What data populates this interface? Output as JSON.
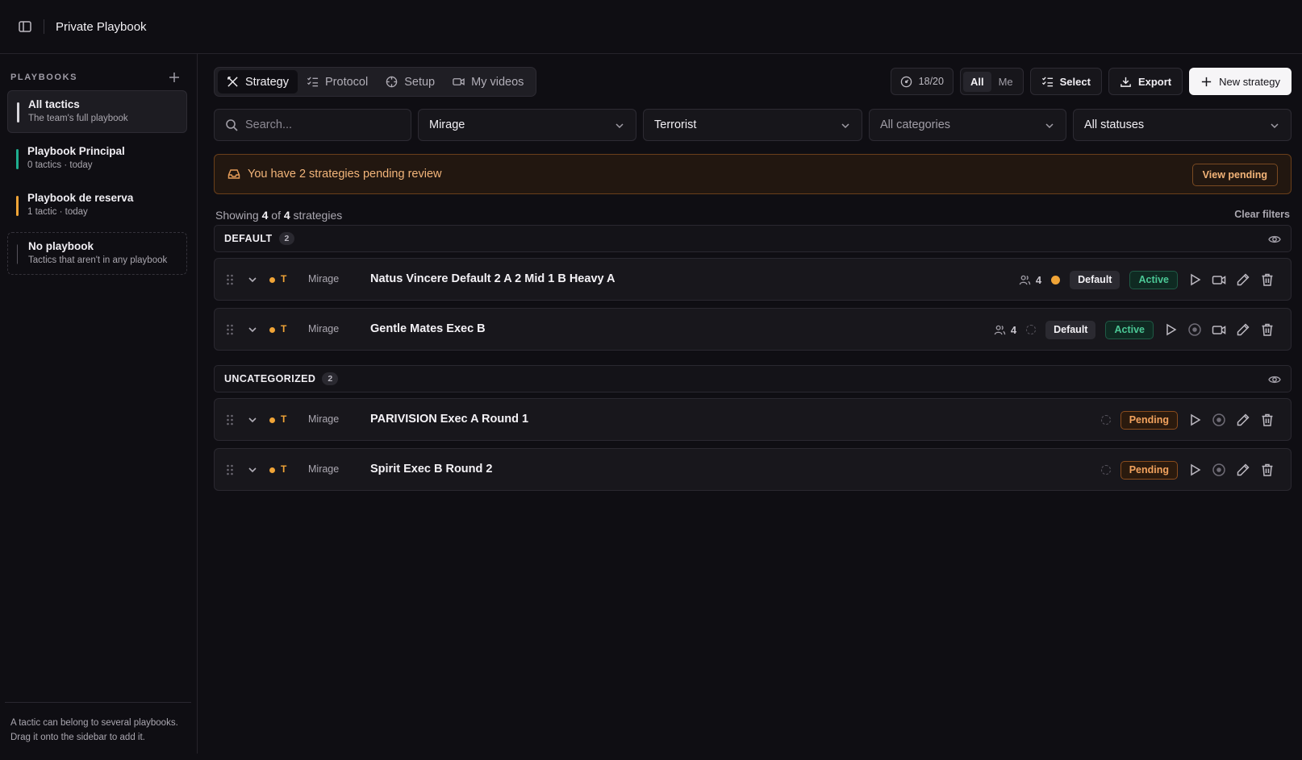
{
  "topbar": {
    "title": "Private Playbook"
  },
  "sidebar": {
    "heading": "PLAYBOOKS",
    "items": [
      {
        "name": "All tactics",
        "sub": "The team's full playbook",
        "color": "#d8d6dc"
      },
      {
        "name": "Playbook Principal",
        "sub": "0 tactics · today",
        "color": "#1fae8f"
      },
      {
        "name": "Playbook de reserva",
        "sub": "1 tactic · today",
        "color": "#f0a437"
      },
      {
        "name": "No playbook",
        "sub": "Tactics that aren't in any playbook",
        "color": ""
      }
    ],
    "footer_line1": "A tactic can belong to several playbooks.",
    "footer_line2": "Drag it onto the sidebar to add it."
  },
  "tabs": [
    "Strategy",
    "Protocol",
    "Setup",
    "My videos"
  ],
  "toolbar": {
    "quota": "18/20",
    "scope_all": "All",
    "scope_me": "Me",
    "select_label": "Select",
    "export_label": "Export",
    "new_label": "New strategy"
  },
  "filters": {
    "search_placeholder": "Search...",
    "map": "Mirage",
    "side": "Terrorist",
    "category": "All categories",
    "status": "All statuses"
  },
  "banner": {
    "text": "You have 2 strategies pending review",
    "button": "View pending"
  },
  "summary": {
    "prefix": "Showing",
    "shown": "4",
    "of": "of",
    "total": "4",
    "suffix": "strategies",
    "clear": "Clear filters"
  },
  "groups": [
    {
      "name": "DEFAULT",
      "count": "2",
      "rows": [
        {
          "side": "T",
          "map": "Mirage",
          "name": "Natus Vincere Default 2 A 2 Mid 1 B Heavy A",
          "players": "4",
          "type": "Default",
          "status": "Active"
        },
        {
          "side": "T",
          "map": "Mirage",
          "name": "Gentle Mates Exec B",
          "players": "4",
          "type": "Default",
          "status": "Active"
        }
      ]
    },
    {
      "name": "UNCATEGORIZED",
      "count": "2",
      "rows": [
        {
          "side": "T",
          "map": "Mirage",
          "name": "PARIVISION Exec A Round 1",
          "status": "Pending"
        },
        {
          "side": "T",
          "map": "Mirage",
          "name": "Spirit Exec B Round 2",
          "status": "Pending"
        }
      ]
    }
  ],
  "colors": {
    "accent": "#f0a437",
    "active": "#4bc795",
    "pending": "#f3a35e",
    "teal": "#1fae8f"
  }
}
